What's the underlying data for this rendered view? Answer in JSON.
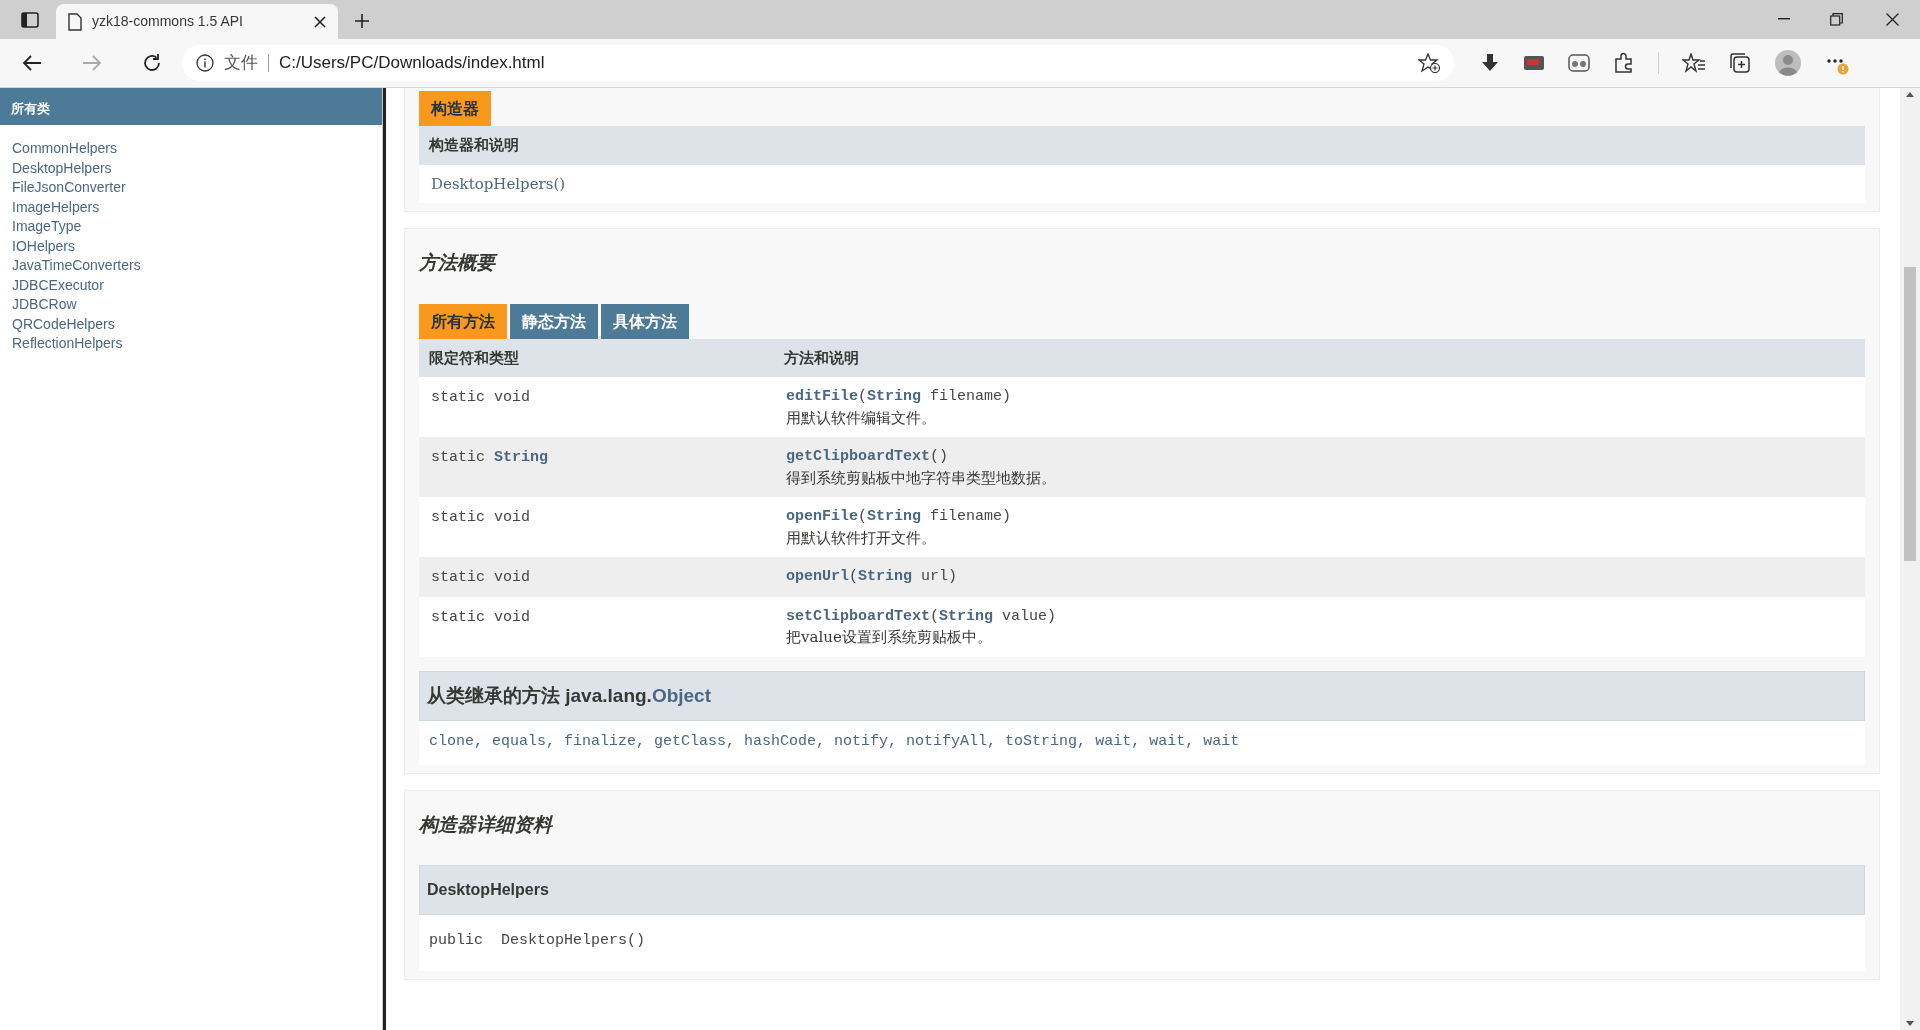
{
  "browser": {
    "tab_title": "yzk18-commons 1.5 API",
    "address_prefix": "文件",
    "url": "C:/Users/PC/Downloads/index.html"
  },
  "sidebar": {
    "title": "所有类",
    "items": [
      "CommonHelpers",
      "DesktopHelpers",
      "FileJsonConverter",
      "ImageHelpers",
      "ImageType",
      "IOHelpers",
      "JavaTimeConverters",
      "JDBCExecutor",
      "JDBCRow",
      "QRCodeHelpers",
      "ReflectionHelpers"
    ]
  },
  "constructor_summary": {
    "tab": "构造器",
    "header": "构造器和说明",
    "rows": [
      "DesktopHelpers()"
    ]
  },
  "method_summary": {
    "title": "方法概要",
    "tabs": [
      {
        "label": "所有方法",
        "selected": true
      },
      {
        "label": "静态方法",
        "selected": false
      },
      {
        "label": "具体方法",
        "selected": false
      }
    ],
    "columns": [
      "限定符和类型",
      "方法和说明"
    ],
    "rows": [
      {
        "type": "static void",
        "signature": "**editFile**(**String** filename)",
        "description": "用默认软件编辑文件。"
      },
      {
        "type": "static **String**",
        "signature": "**getClipboardText**()",
        "description": "得到系统剪贴板中地字符串类型地数据。"
      },
      {
        "type": "static void",
        "signature": "**openFile**(**String** filename)",
        "description": "用默认软件打开文件。"
      },
      {
        "type": "static void",
        "signature": "**openUrl**(**String** url)"
      },
      {
        "type": "static void",
        "signature": "**setClipboardText**(**String** value)",
        "description": "把value设置到系统剪贴板中。"
      }
    ],
    "inherited": {
      "prefix": "从类继承的方法 java.lang.",
      "link": "Object",
      "methods": [
        "clone,",
        "equals,",
        "finalize,",
        "getClass,",
        "hashCode,",
        "notify,",
        "notifyAll,",
        "toString,",
        "wait,",
        "wait,",
        "wait"
      ]
    }
  },
  "constructor_detail": {
    "title": "构造器详细资料",
    "header": "DesktopHelpers",
    "signature": "public  DesktopHelpers()"
  }
}
